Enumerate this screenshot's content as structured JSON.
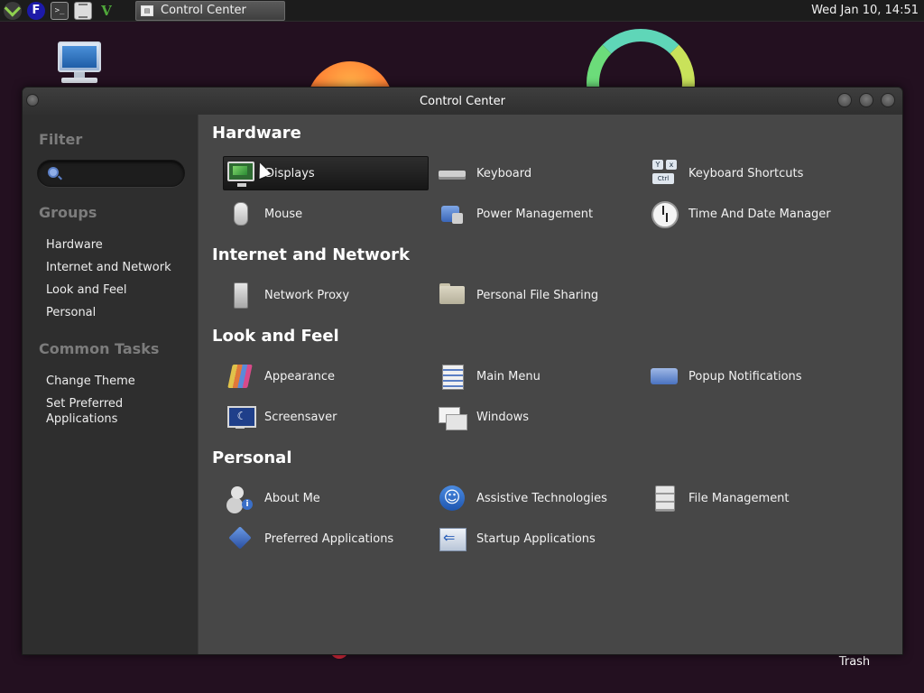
{
  "panel": {
    "task_label": "Control Center",
    "clock": "Wed Jan 10, 14:51"
  },
  "desktop": {
    "trash_label": "Trash"
  },
  "window": {
    "title": "Control Center"
  },
  "sidebar": {
    "filter_heading": "Filter",
    "search_placeholder": "",
    "groups_heading": "Groups",
    "groups": [
      "Hardware",
      "Internet and Network",
      "Look and Feel",
      "Personal"
    ],
    "tasks_heading": "Common Tasks",
    "tasks": [
      "Change Theme",
      "Set Preferred Applications"
    ]
  },
  "main": {
    "sections": [
      {
        "title": "Hardware",
        "items": [
          {
            "label": "Displays",
            "icon": "display-icon",
            "selected": true
          },
          {
            "label": "Keyboard",
            "icon": "keyboard-icon"
          },
          {
            "label": "Keyboard Shortcuts",
            "icon": "keyboard-shortcuts-icon"
          },
          {
            "label": "Mouse",
            "icon": "mouse-icon"
          },
          {
            "label": "Power Management",
            "icon": "power-icon"
          },
          {
            "label": "Time And Date Manager",
            "icon": "clock-icon"
          }
        ]
      },
      {
        "title": "Internet and Network",
        "items": [
          {
            "label": "Network Proxy",
            "icon": "network-proxy-icon"
          },
          {
            "label": "Personal File Sharing",
            "icon": "folder-share-icon"
          }
        ]
      },
      {
        "title": "Look and Feel",
        "items": [
          {
            "label": "Appearance",
            "icon": "appearance-icon"
          },
          {
            "label": "Main Menu",
            "icon": "main-menu-icon"
          },
          {
            "label": "Popup Notifications",
            "icon": "popup-notification-icon"
          },
          {
            "label": "Screensaver",
            "icon": "screensaver-icon"
          },
          {
            "label": "Windows",
            "icon": "windows-icon"
          }
        ]
      },
      {
        "title": "Personal",
        "items": [
          {
            "label": "About Me",
            "icon": "about-me-icon"
          },
          {
            "label": "Assistive Technologies",
            "icon": "accessibility-icon"
          },
          {
            "label": "File Management",
            "icon": "file-cabinet-icon"
          },
          {
            "label": "Preferred Applications",
            "icon": "preferred-apps-icon"
          },
          {
            "label": "Startup Applications",
            "icon": "startup-apps-icon"
          }
        ]
      }
    ]
  },
  "colors": {
    "content_bg": "#474747",
    "sidebar_bg": "#2e2e2e",
    "panel_bg": "#1c1c1c",
    "desktop_bg": "#231020"
  }
}
